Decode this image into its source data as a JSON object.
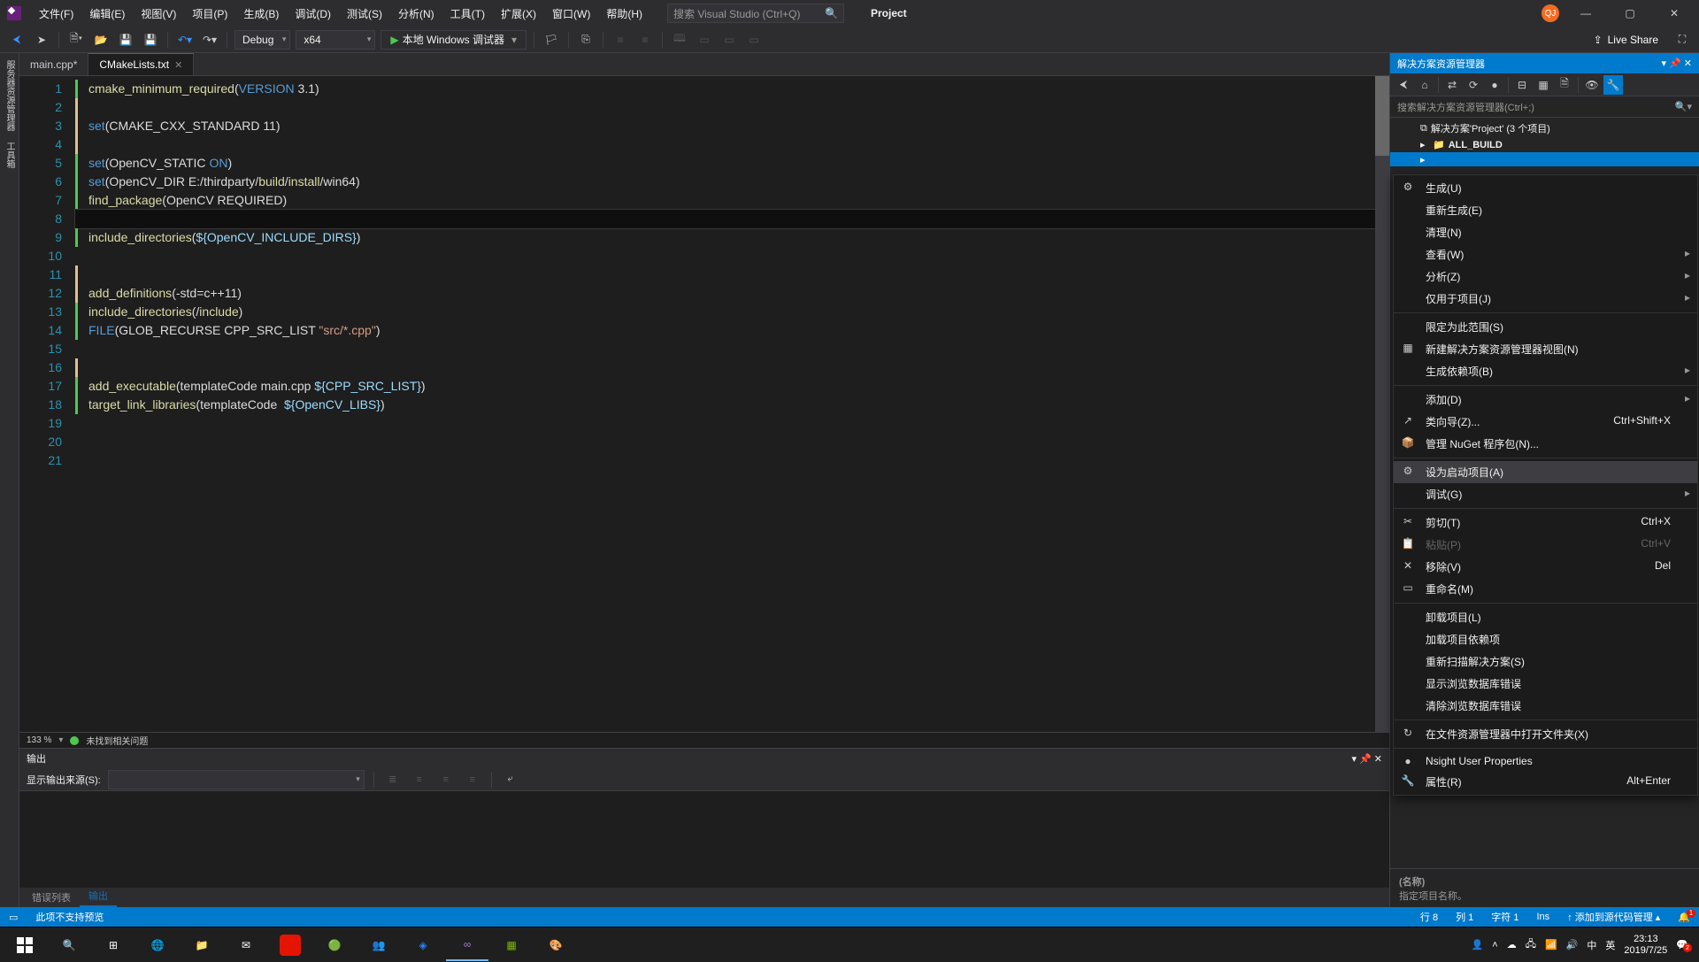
{
  "menubar": [
    "文件(F)",
    "编辑(E)",
    "视图(V)",
    "项目(P)",
    "生成(B)",
    "调试(D)",
    "测试(S)",
    "分析(N)",
    "工具(T)",
    "扩展(X)",
    "窗口(W)",
    "帮助(H)"
  ],
  "search_placeholder": "搜索 Visual Studio (Ctrl+Q)",
  "project_label": "Project",
  "user_initials": "QJ",
  "toolbar": {
    "config": "Debug",
    "platform": "x64",
    "debug_target": "本地 Windows 调试器",
    "live_share": "Live Share"
  },
  "tabs": [
    {
      "label": "main.cpp*",
      "active": false
    },
    {
      "label": "CMakeLists.txt",
      "active": true
    }
  ],
  "zoom": "133 %",
  "no_issues": "未找到相关问题",
  "code_lines": [
    {
      "n": 1,
      "m": "saved",
      "seg": [
        {
          "t": "cmake_minimum_required",
          "c": "fn"
        },
        {
          "t": "(",
          "c": ""
        },
        {
          "t": "VERSION",
          "c": "kw"
        },
        {
          "t": " 3.1)",
          "c": ""
        }
      ]
    },
    {
      "n": 2,
      "m": "changed",
      "seg": []
    },
    {
      "n": 3,
      "m": "changed",
      "seg": [
        {
          "t": "set",
          "c": "kw"
        },
        {
          "t": "(CMAKE_CXX_STANDARD 11)",
          "c": ""
        }
      ]
    },
    {
      "n": 4,
      "m": "changed",
      "seg": []
    },
    {
      "n": 5,
      "m": "saved",
      "seg": [
        {
          "t": "set",
          "c": "kw"
        },
        {
          "t": "(OpenCV_STATIC ",
          "c": ""
        },
        {
          "t": "ON",
          "c": "kw"
        },
        {
          "t": ")",
          "c": ""
        }
      ]
    },
    {
      "n": 6,
      "m": "saved",
      "seg": [
        {
          "t": "set",
          "c": "kw"
        },
        {
          "t": "(OpenCV_DIR E:/thirdparty/",
          "c": ""
        },
        {
          "t": "build",
          "c": "fn"
        },
        {
          "t": "/",
          "c": ""
        },
        {
          "t": "install",
          "c": "fn"
        },
        {
          "t": "/win64)",
          "c": ""
        }
      ]
    },
    {
      "n": 7,
      "m": "saved",
      "seg": [
        {
          "t": "find_package",
          "c": "fn"
        },
        {
          "t": "(OpenCV REQUIRED)",
          "c": ""
        }
      ]
    },
    {
      "n": 8,
      "m": "",
      "seg": [],
      "cur": true
    },
    {
      "n": 9,
      "m": "saved",
      "seg": [
        {
          "t": "include_directories",
          "c": "fn"
        },
        {
          "t": "(",
          "c": ""
        },
        {
          "t": "${OpenCV_INCLUDE_DIRS}",
          "c": "var"
        },
        {
          "t": ")",
          "c": ""
        }
      ]
    },
    {
      "n": 10,
      "m": "",
      "seg": []
    },
    {
      "n": 11,
      "m": "changed",
      "seg": []
    },
    {
      "n": 12,
      "m": "changed",
      "seg": [
        {
          "t": "add_definitions",
          "c": "fn"
        },
        {
          "t": "(-std=c++11)",
          "c": ""
        }
      ]
    },
    {
      "n": 13,
      "m": "saved",
      "seg": [
        {
          "t": "include_directories",
          "c": "fn"
        },
        {
          "t": "(/",
          "c": ""
        },
        {
          "t": "include",
          "c": "fn"
        },
        {
          "t": ")",
          "c": ""
        }
      ]
    },
    {
      "n": 14,
      "m": "saved",
      "seg": [
        {
          "t": "FILE",
          "c": "kw"
        },
        {
          "t": "(GLOB_RECURSE CPP_SRC_LIST ",
          "c": ""
        },
        {
          "t": "\"src/*.cpp\"",
          "c": "str"
        },
        {
          "t": ")",
          "c": ""
        }
      ]
    },
    {
      "n": 15,
      "m": "",
      "seg": []
    },
    {
      "n": 16,
      "m": "changed",
      "seg": []
    },
    {
      "n": 17,
      "m": "saved",
      "seg": [
        {
          "t": "add_executable",
          "c": "fn"
        },
        {
          "t": "(templateCode main.cpp ",
          "c": ""
        },
        {
          "t": "${CPP_SRC_LIST}",
          "c": "var"
        },
        {
          "t": ")",
          "c": ""
        }
      ]
    },
    {
      "n": 18,
      "m": "saved",
      "seg": [
        {
          "t": "target_link_libraries",
          "c": "fn"
        },
        {
          "t": "(templateCode  ",
          "c": ""
        },
        {
          "t": "${OpenCV_LIBS}",
          "c": "var"
        },
        {
          "t": ")",
          "c": ""
        }
      ]
    },
    {
      "n": 19,
      "m": "",
      "seg": []
    },
    {
      "n": 20,
      "m": "",
      "seg": []
    },
    {
      "n": 21,
      "m": "",
      "seg": []
    }
  ],
  "solution_explorer": {
    "title": "解决方案资源管理器",
    "search": "搜索解决方案资源管理器(Ctrl+;)",
    "root": "解决方案'Project' (3 个项目)",
    "items": [
      "ALL_BUILD"
    ]
  },
  "context_menu": [
    {
      "type": "item",
      "icon": "⚙",
      "label": "生成(U)"
    },
    {
      "type": "item",
      "label": "重新生成(E)"
    },
    {
      "type": "item",
      "label": "清理(N)"
    },
    {
      "type": "item",
      "label": "查看(W)",
      "arrow": true
    },
    {
      "type": "item",
      "label": "分析(Z)",
      "arrow": true
    },
    {
      "type": "item",
      "label": "仅用于项目(J)",
      "arrow": true
    },
    {
      "type": "sep"
    },
    {
      "type": "item",
      "label": "限定为此范围(S)"
    },
    {
      "type": "item",
      "icon": "▦",
      "label": "新建解决方案资源管理器视图(N)"
    },
    {
      "type": "item",
      "label": "生成依赖项(B)",
      "arrow": true
    },
    {
      "type": "sep"
    },
    {
      "type": "item",
      "label": "添加(D)",
      "arrow": true
    },
    {
      "type": "item",
      "icon": "↗",
      "label": "类向导(Z)...",
      "shortcut": "Ctrl+Shift+X"
    },
    {
      "type": "item",
      "icon": "📦",
      "label": "管理 NuGet 程序包(N)..."
    },
    {
      "type": "sep"
    },
    {
      "type": "item",
      "icon": "⚙",
      "label": "设为启动项目(A)",
      "hov": true
    },
    {
      "type": "item",
      "label": "调试(G)",
      "arrow": true
    },
    {
      "type": "sep"
    },
    {
      "type": "item",
      "icon": "✂",
      "label": "剪切(T)",
      "shortcut": "Ctrl+X"
    },
    {
      "type": "item",
      "icon": "📋",
      "label": "粘贴(P)",
      "shortcut": "Ctrl+V",
      "disabled": true
    },
    {
      "type": "item",
      "icon": "✕",
      "label": "移除(V)",
      "shortcut": "Del"
    },
    {
      "type": "item",
      "icon": "▭",
      "label": "重命名(M)"
    },
    {
      "type": "sep"
    },
    {
      "type": "item",
      "label": "卸载项目(L)"
    },
    {
      "type": "item",
      "label": "加载项目依赖项"
    },
    {
      "type": "item",
      "label": "重新扫描解决方案(S)"
    },
    {
      "type": "item",
      "label": "显示浏览数据库错误"
    },
    {
      "type": "item",
      "label": "清除浏览数据库错误"
    },
    {
      "type": "sep"
    },
    {
      "type": "item",
      "icon": "↻",
      "label": "在文件资源管理器中打开文件夹(X)"
    },
    {
      "type": "sep"
    },
    {
      "type": "item",
      "icon": "●",
      "label": "Nsight User Properties"
    },
    {
      "type": "item",
      "icon": "🔧",
      "label": "属性(R)",
      "shortcut": "Alt+Enter"
    }
  ],
  "output": {
    "title": "输出",
    "source_label": "显示输出来源(S):",
    "tabs": [
      "错误列表",
      "输出"
    ]
  },
  "props": {
    "name_label": "(名称)",
    "desc": "指定项目名称。"
  },
  "status": {
    "preview": "此项不支持预览",
    "line": "行 8",
    "col": "列 1",
    "char": "字符 1",
    "ins": "Ins",
    "scm": "添加到源代码管理"
  },
  "tray": {
    "ime1": "中",
    "ime2": "英",
    "time": "23:13",
    "date": "2019/7/25"
  }
}
